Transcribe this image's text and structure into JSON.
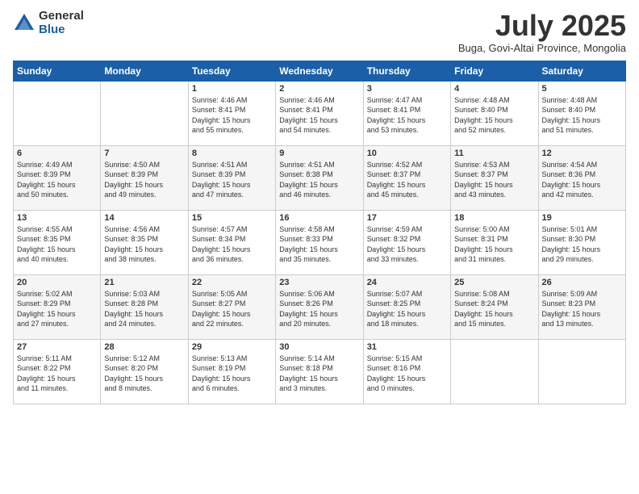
{
  "logo": {
    "general": "General",
    "blue": "Blue"
  },
  "header": {
    "month": "July 2025",
    "location": "Buga, Govi-Altai Province, Mongolia"
  },
  "weekdays": [
    "Sunday",
    "Monday",
    "Tuesday",
    "Wednesday",
    "Thursday",
    "Friday",
    "Saturday"
  ],
  "weeks": [
    [
      {
        "day": "",
        "info": ""
      },
      {
        "day": "",
        "info": ""
      },
      {
        "day": "1",
        "info": "Sunrise: 4:46 AM\nSunset: 8:41 PM\nDaylight: 15 hours\nand 55 minutes."
      },
      {
        "day": "2",
        "info": "Sunrise: 4:46 AM\nSunset: 8:41 PM\nDaylight: 15 hours\nand 54 minutes."
      },
      {
        "day": "3",
        "info": "Sunrise: 4:47 AM\nSunset: 8:41 PM\nDaylight: 15 hours\nand 53 minutes."
      },
      {
        "day": "4",
        "info": "Sunrise: 4:48 AM\nSunset: 8:40 PM\nDaylight: 15 hours\nand 52 minutes."
      },
      {
        "day": "5",
        "info": "Sunrise: 4:48 AM\nSunset: 8:40 PM\nDaylight: 15 hours\nand 51 minutes."
      }
    ],
    [
      {
        "day": "6",
        "info": "Sunrise: 4:49 AM\nSunset: 8:39 PM\nDaylight: 15 hours\nand 50 minutes."
      },
      {
        "day": "7",
        "info": "Sunrise: 4:50 AM\nSunset: 8:39 PM\nDaylight: 15 hours\nand 49 minutes."
      },
      {
        "day": "8",
        "info": "Sunrise: 4:51 AM\nSunset: 8:39 PM\nDaylight: 15 hours\nand 47 minutes."
      },
      {
        "day": "9",
        "info": "Sunrise: 4:51 AM\nSunset: 8:38 PM\nDaylight: 15 hours\nand 46 minutes."
      },
      {
        "day": "10",
        "info": "Sunrise: 4:52 AM\nSunset: 8:37 PM\nDaylight: 15 hours\nand 45 minutes."
      },
      {
        "day": "11",
        "info": "Sunrise: 4:53 AM\nSunset: 8:37 PM\nDaylight: 15 hours\nand 43 minutes."
      },
      {
        "day": "12",
        "info": "Sunrise: 4:54 AM\nSunset: 8:36 PM\nDaylight: 15 hours\nand 42 minutes."
      }
    ],
    [
      {
        "day": "13",
        "info": "Sunrise: 4:55 AM\nSunset: 8:35 PM\nDaylight: 15 hours\nand 40 minutes."
      },
      {
        "day": "14",
        "info": "Sunrise: 4:56 AM\nSunset: 8:35 PM\nDaylight: 15 hours\nand 38 minutes."
      },
      {
        "day": "15",
        "info": "Sunrise: 4:57 AM\nSunset: 8:34 PM\nDaylight: 15 hours\nand 36 minutes."
      },
      {
        "day": "16",
        "info": "Sunrise: 4:58 AM\nSunset: 8:33 PM\nDaylight: 15 hours\nand 35 minutes."
      },
      {
        "day": "17",
        "info": "Sunrise: 4:59 AM\nSunset: 8:32 PM\nDaylight: 15 hours\nand 33 minutes."
      },
      {
        "day": "18",
        "info": "Sunrise: 5:00 AM\nSunset: 8:31 PM\nDaylight: 15 hours\nand 31 minutes."
      },
      {
        "day": "19",
        "info": "Sunrise: 5:01 AM\nSunset: 8:30 PM\nDaylight: 15 hours\nand 29 minutes."
      }
    ],
    [
      {
        "day": "20",
        "info": "Sunrise: 5:02 AM\nSunset: 8:29 PM\nDaylight: 15 hours\nand 27 minutes."
      },
      {
        "day": "21",
        "info": "Sunrise: 5:03 AM\nSunset: 8:28 PM\nDaylight: 15 hours\nand 24 minutes."
      },
      {
        "day": "22",
        "info": "Sunrise: 5:05 AM\nSunset: 8:27 PM\nDaylight: 15 hours\nand 22 minutes."
      },
      {
        "day": "23",
        "info": "Sunrise: 5:06 AM\nSunset: 8:26 PM\nDaylight: 15 hours\nand 20 minutes."
      },
      {
        "day": "24",
        "info": "Sunrise: 5:07 AM\nSunset: 8:25 PM\nDaylight: 15 hours\nand 18 minutes."
      },
      {
        "day": "25",
        "info": "Sunrise: 5:08 AM\nSunset: 8:24 PM\nDaylight: 15 hours\nand 15 minutes."
      },
      {
        "day": "26",
        "info": "Sunrise: 5:09 AM\nSunset: 8:23 PM\nDaylight: 15 hours\nand 13 minutes."
      }
    ],
    [
      {
        "day": "27",
        "info": "Sunrise: 5:11 AM\nSunset: 8:22 PM\nDaylight: 15 hours\nand 11 minutes."
      },
      {
        "day": "28",
        "info": "Sunrise: 5:12 AM\nSunset: 8:20 PM\nDaylight: 15 hours\nand 8 minutes."
      },
      {
        "day": "29",
        "info": "Sunrise: 5:13 AM\nSunset: 8:19 PM\nDaylight: 15 hours\nand 6 minutes."
      },
      {
        "day": "30",
        "info": "Sunrise: 5:14 AM\nSunset: 8:18 PM\nDaylight: 15 hours\nand 3 minutes."
      },
      {
        "day": "31",
        "info": "Sunrise: 5:15 AM\nSunset: 8:16 PM\nDaylight: 15 hours\nand 0 minutes."
      },
      {
        "day": "",
        "info": ""
      },
      {
        "day": "",
        "info": ""
      }
    ]
  ]
}
